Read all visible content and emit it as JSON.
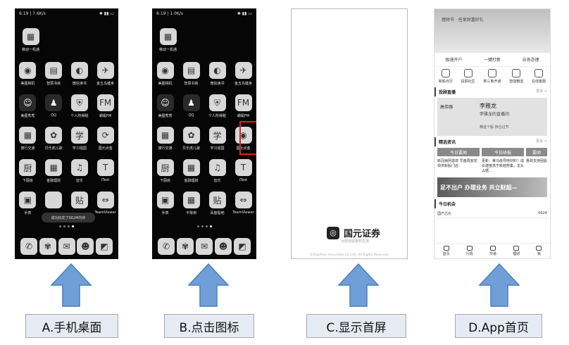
{
  "phoneA": {
    "status": "6:19 | 7.6K/s",
    "folder": "移动一机通",
    "apps": [
      {
        "label": "美图相机",
        "icon": "camera-icon",
        "glyph": "◉"
      },
      {
        "label": "智慧书房",
        "icon": "book-icon",
        "glyph": "▤"
      },
      {
        "label": "微信读书",
        "icon": "toggle-icon",
        "glyph": "◐"
      },
      {
        "label": "金五鸟健身",
        "icon": "bird-icon",
        "glyph": "✈"
      },
      {
        "label": "美图秀秀",
        "icon": "face-icon",
        "glyph": "☺"
      },
      {
        "label": "QQ",
        "icon": "penguin-icon",
        "glyph": "♟"
      },
      {
        "label": "个人所得税",
        "icon": "shield-icon",
        "glyph": "⛨"
      },
      {
        "label": "蜻蜓FM",
        "icon": "radio-icon",
        "glyph": "FM"
      },
      {
        "label": "旅行交通",
        "icon": "train-icon",
        "glyph": "▦"
      },
      {
        "label": "贝乐虎儿歌",
        "icon": "tiger-icon",
        "glyph": "✿"
      },
      {
        "label": "学习强国",
        "icon": "calligraphy-icon",
        "glyph": "学"
      },
      {
        "label": "国元点金",
        "icon": "refresh-icon",
        "glyph": "⟳"
      },
      {
        "label": "下厨房",
        "icon": "kitchen-icon",
        "glyph": "厨"
      },
      {
        "label": "金融理财",
        "icon": "finance-icon",
        "glyph": "▦"
      },
      {
        "label": "音乐",
        "icon": "music-icon",
        "glyph": "♫"
      },
      {
        "label": "iTest",
        "icon": "t-icon",
        "glyph": "T"
      },
      {
        "label": "手表",
        "icon": "watch-icon",
        "glyph": "▣"
      },
      {
        "label": "",
        "icon": "blank-icon",
        "glyph": ""
      },
      {
        "label": "",
        "icon": "sticker-icon",
        "glyph": "贴"
      },
      {
        "label": "TeamViewer",
        "icon": "teamviewer-icon",
        "glyph": "⇔"
      }
    ],
    "toast": "成功标定了662M内存",
    "dock": [
      {
        "icon": "phone-icon",
        "glyph": "✆"
      },
      {
        "icon": "flower-icon",
        "glyph": "✾"
      },
      {
        "icon": "chat-icon",
        "glyph": "✉"
      },
      {
        "icon": "cat-icon",
        "glyph": "☻"
      },
      {
        "icon": "gallery-icon",
        "glyph": "◩"
      }
    ]
  },
  "phoneB": {
    "status": "6:19 | 1.0K/s",
    "folder": "移动一机通",
    "apps": [
      {
        "label": "美图相机",
        "icon": "camera-icon",
        "glyph": "◉"
      },
      {
        "label": "智慧书房",
        "icon": "book-icon",
        "glyph": "▤"
      },
      {
        "label": "微信读书",
        "icon": "toggle-icon",
        "glyph": "◐"
      },
      {
        "label": "金五鸟健身",
        "icon": "bird-icon",
        "glyph": "✈"
      },
      {
        "label": "美图秀秀",
        "icon": "face-icon",
        "glyph": "☺"
      },
      {
        "label": "QQ",
        "icon": "penguin-icon",
        "glyph": "♟"
      },
      {
        "label": "个人所得税",
        "icon": "shield-icon",
        "glyph": "⛨"
      },
      {
        "label": "蜻蜓FM",
        "icon": "radio-icon",
        "glyph": "FM"
      },
      {
        "label": "旅行交通",
        "icon": "train-icon",
        "glyph": "▦"
      },
      {
        "label": "贝乐虎儿歌",
        "icon": "tiger-icon",
        "glyph": "✿"
      },
      {
        "label": "学习强国",
        "icon": "calligraphy-icon",
        "glyph": "学"
      },
      {
        "label": "国元点金",
        "icon": "guoyuan-icon",
        "glyph": "◉"
      },
      {
        "label": "下厨房",
        "icon": "kitchen-icon",
        "glyph": "厨"
      },
      {
        "label": "金融理财",
        "icon": "finance-icon",
        "glyph": "▦"
      },
      {
        "label": "音乐",
        "icon": "music-icon",
        "glyph": "♫"
      },
      {
        "label": "iTest",
        "icon": "t-icon",
        "glyph": "T"
      },
      {
        "label": "手表",
        "icon": "watch-icon",
        "glyph": "▣"
      },
      {
        "label": "不常用",
        "icon": "folder-icon",
        "glyph": "▦"
      },
      {
        "label": "百度贴吧",
        "icon": "sticker-icon",
        "glyph": "贴"
      },
      {
        "label": "TeamViewer",
        "icon": "teamviewer-icon",
        "glyph": "⇔"
      }
    ],
    "dock": [
      {
        "icon": "phone-icon",
        "glyph": "✆"
      },
      {
        "icon": "flower-icon",
        "glyph": "✾"
      },
      {
        "icon": "chat-icon",
        "glyph": "✉"
      },
      {
        "icon": "cat-icon",
        "glyph": "☻"
      },
      {
        "icon": "gallery-icon",
        "glyph": "◩"
      }
    ]
  },
  "splash": {
    "logo_glyph": "◎",
    "name": "国元证券",
    "tagline": "为您创造更好生活",
    "copyright": "©GuoYuan Securities Co.,Ltd. All Rights Reserved"
  },
  "home": {
    "banner": "理财节 · 任享财富好礼",
    "quick": [
      "极速开户",
      "一键打新",
      "业务办理"
    ],
    "icons": [
      "新股日历",
      "投顾社区",
      "新三板开通",
      "智能精选",
      "在线客服"
    ],
    "live_head": "投顾直播",
    "more": "更多 >",
    "live_left": "高伟强",
    "live_title": "李雅龙",
    "live_sub": "李雅龙的直播间",
    "live_bottom": "精选个股 持仓过节",
    "news_head": "精选资讯",
    "tabs": [
      "今日要闻",
      "今日研报",
      "要闻"
    ],
    "news": [
      "新冠病例激增 早盘再度发现供新股门店",
      "更新：莱马级导电材料！成长建度高于新趋势集，龙头占据…",
      "惠政支持团股"
    ],
    "promo": "足不出户 办理业务 共立财超—",
    "chance_head": "今日机会",
    "chance_item": "国产芯片",
    "chance_val": "0624",
    "nav": [
      "首页",
      "行情",
      "交易",
      "理财",
      "我"
    ]
  },
  "captions": [
    "A.手机桌面",
    "B.点击图标",
    "C.显示首屏",
    "D.App首页"
  ],
  "colors": {
    "arrow": "#6f9fd6",
    "arrow_stroke": "#4a7fbf",
    "caption_bg": "#e6ebf3",
    "highlight": "#e02020"
  }
}
